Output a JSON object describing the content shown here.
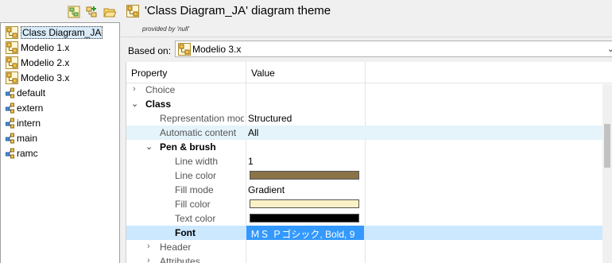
{
  "left_pane": {
    "toolbar": {
      "icons": [
        "new-theme-icon",
        "add-theme-icon",
        "open-folder-icon"
      ]
    },
    "items": [
      {
        "label": "Class Diagram_JA",
        "icon": "diagram-theme-icon",
        "selected": true
      },
      {
        "label": "Modelio 1.x",
        "icon": "diagram-theme-icon"
      },
      {
        "label": "Modelio 2.x",
        "icon": "diagram-theme-icon"
      },
      {
        "label": "Modelio 3.x",
        "icon": "diagram-theme-icon"
      },
      {
        "label": "default",
        "icon": "style-icon"
      },
      {
        "label": "extern",
        "icon": "style-icon"
      },
      {
        "label": "intern",
        "icon": "style-icon"
      },
      {
        "label": "main",
        "icon": "style-icon"
      },
      {
        "label": "ramc",
        "icon": "style-icon"
      }
    ]
  },
  "header": {
    "title": "'Class Diagram_JA' diagram theme",
    "provided_by": "provided by 'null'"
  },
  "based_on": {
    "label": "Based on:",
    "value": "Modelio 3.x"
  },
  "table": {
    "headers": {
      "property": "Property",
      "value": "Value"
    },
    "rows": [
      {
        "name": "Choice",
        "value": "",
        "kind": "group-collapsed"
      },
      {
        "name": "Class",
        "value": "",
        "kind": "group-open"
      },
      {
        "name": "Representation mode",
        "value": "Structured"
      },
      {
        "name": "Automatic content",
        "value": "All"
      },
      {
        "name": "Pen & brush",
        "value": "",
        "kind": "subgroup-open"
      },
      {
        "name": "Line width",
        "value": "1"
      },
      {
        "name": "Line color",
        "value": "",
        "color": "#8b7348"
      },
      {
        "name": "Fill mode",
        "value": "Gradient"
      },
      {
        "name": "Fill color",
        "value": "",
        "color": "#fbf1c8"
      },
      {
        "name": "Text color",
        "value": "",
        "color": "#000000"
      },
      {
        "name": "Font",
        "value": "ＭＳ Ｐゴシック, Bold, 9"
      },
      {
        "name": "Header",
        "value": "",
        "kind": "subgroup-collapsed"
      },
      {
        "name": "Attributes",
        "value": "",
        "kind": "subgroup-collapsed"
      }
    ]
  }
}
